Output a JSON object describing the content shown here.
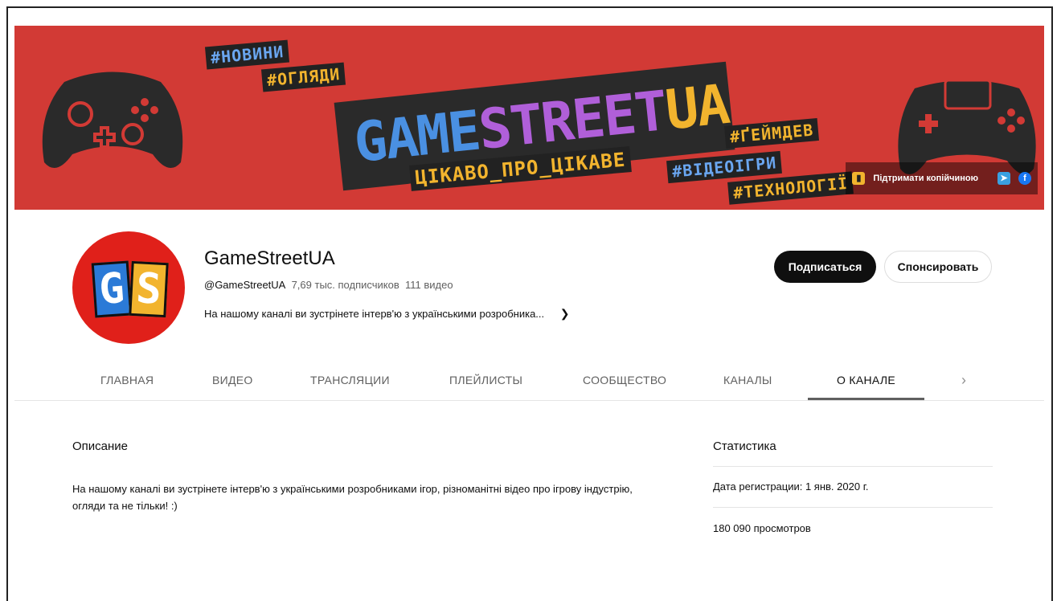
{
  "banner": {
    "logo_left": "GAME",
    "logo_mid": "STREET",
    "logo_right": "UA",
    "tags": {
      "news": "#НОВИНИ",
      "reviews": "#ОГЛЯДИ",
      "interesting": "ЦІКАВО_ПРО_ЦІКАВЕ",
      "gamedev": "#ҐЕЙМДЕВ",
      "videogames": "#ВІДЕОІГРИ",
      "tech": "#ТЕХНОЛОГІЇ"
    },
    "links": {
      "support_label": "Підтримати копійчиною"
    }
  },
  "channel": {
    "avatar_letters": [
      "G",
      "S"
    ],
    "name": "GameStreetUA",
    "handle": "@GameStreetUA",
    "subscribers": "7,69 тыс. подписчиков",
    "videos": "111 видео",
    "description_short": "На нашому каналі ви зустрінете інтерв'ю з українськими розробника...",
    "subscribe_label": "Подписаться",
    "sponsor_label": "Спонсировать"
  },
  "tabs": [
    {
      "label": "ГЛАВНАЯ"
    },
    {
      "label": "ВИДЕО"
    },
    {
      "label": "ТРАНСЛЯЦИИ"
    },
    {
      "label": "ПЛЕЙЛИСТЫ"
    },
    {
      "label": "СООБЩЕСТВО"
    },
    {
      "label": "КАНАЛЫ"
    },
    {
      "label": "О КАНАЛЕ"
    }
  ],
  "about": {
    "description_title": "Описание",
    "description_text": "На нашому каналі ви зустрінете інтерв'ю з українськими розробниками ігор, різноманітні відео про ігрову індустрію, огляди та не тільки! :)",
    "stats_title": "Статистика",
    "registered": "Дата регистрации: 1 янв. 2020 г.",
    "views": "180 090 просмотров"
  },
  "colors": {
    "banner_bg": "#d23a35",
    "logo_blue": "#4a90e2",
    "logo_purple": "#b05fd9",
    "logo_yellow": "#f2b42e",
    "tag_blue": "#6aa6f0",
    "tag_yellow": "#f2b42e"
  }
}
